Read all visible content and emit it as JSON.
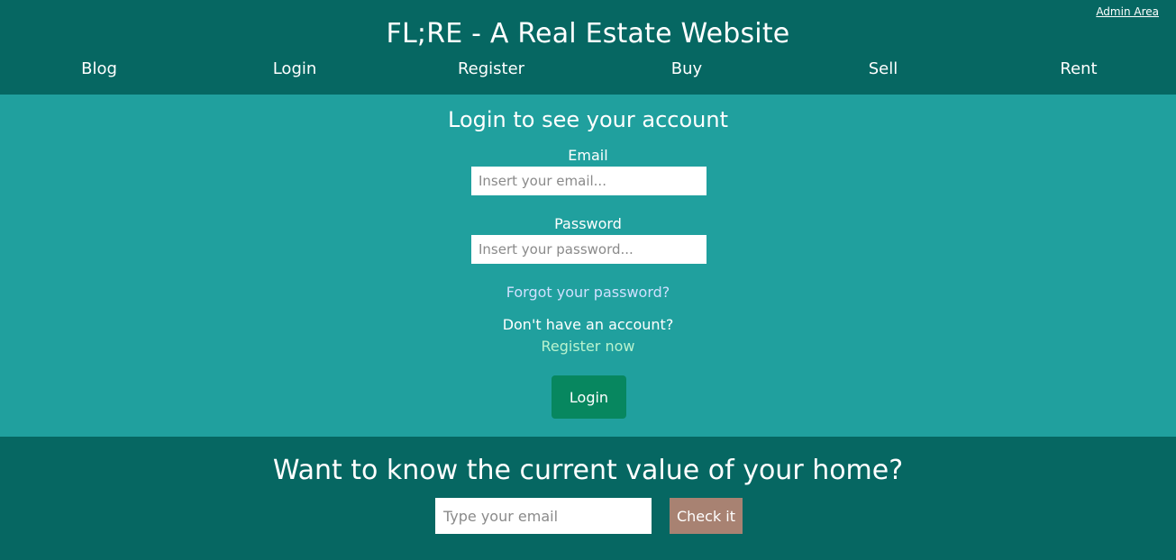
{
  "header": {
    "admin_link": "Admin Area",
    "title": "FL;RE - A Real Estate Website",
    "nav": [
      "Blog",
      "Login",
      "Register",
      "Buy",
      "Sell",
      "Rent"
    ]
  },
  "login": {
    "heading": "Login to see your account",
    "email_label": "Email",
    "email_placeholder": "Insert your email...",
    "email_value": "",
    "password_label": "Password",
    "password_placeholder": "Insert your password...",
    "password_value": "",
    "forgot_link": "Forgot your password?",
    "no_account_text": "Don't have an account?",
    "register_link": "Register now",
    "login_button": "Login"
  },
  "valuation": {
    "heading": "Want to know the current value of your home?",
    "email_placeholder": "Type your email",
    "email_value": "",
    "check_button": "Check it"
  },
  "colors": {
    "header_bg": "#066762",
    "login_bg": "#20a09e",
    "login_button": "#07875f",
    "check_button": "#a88272",
    "forgot_link": "#cfe0ff",
    "register_link": "#b9f3cf"
  }
}
